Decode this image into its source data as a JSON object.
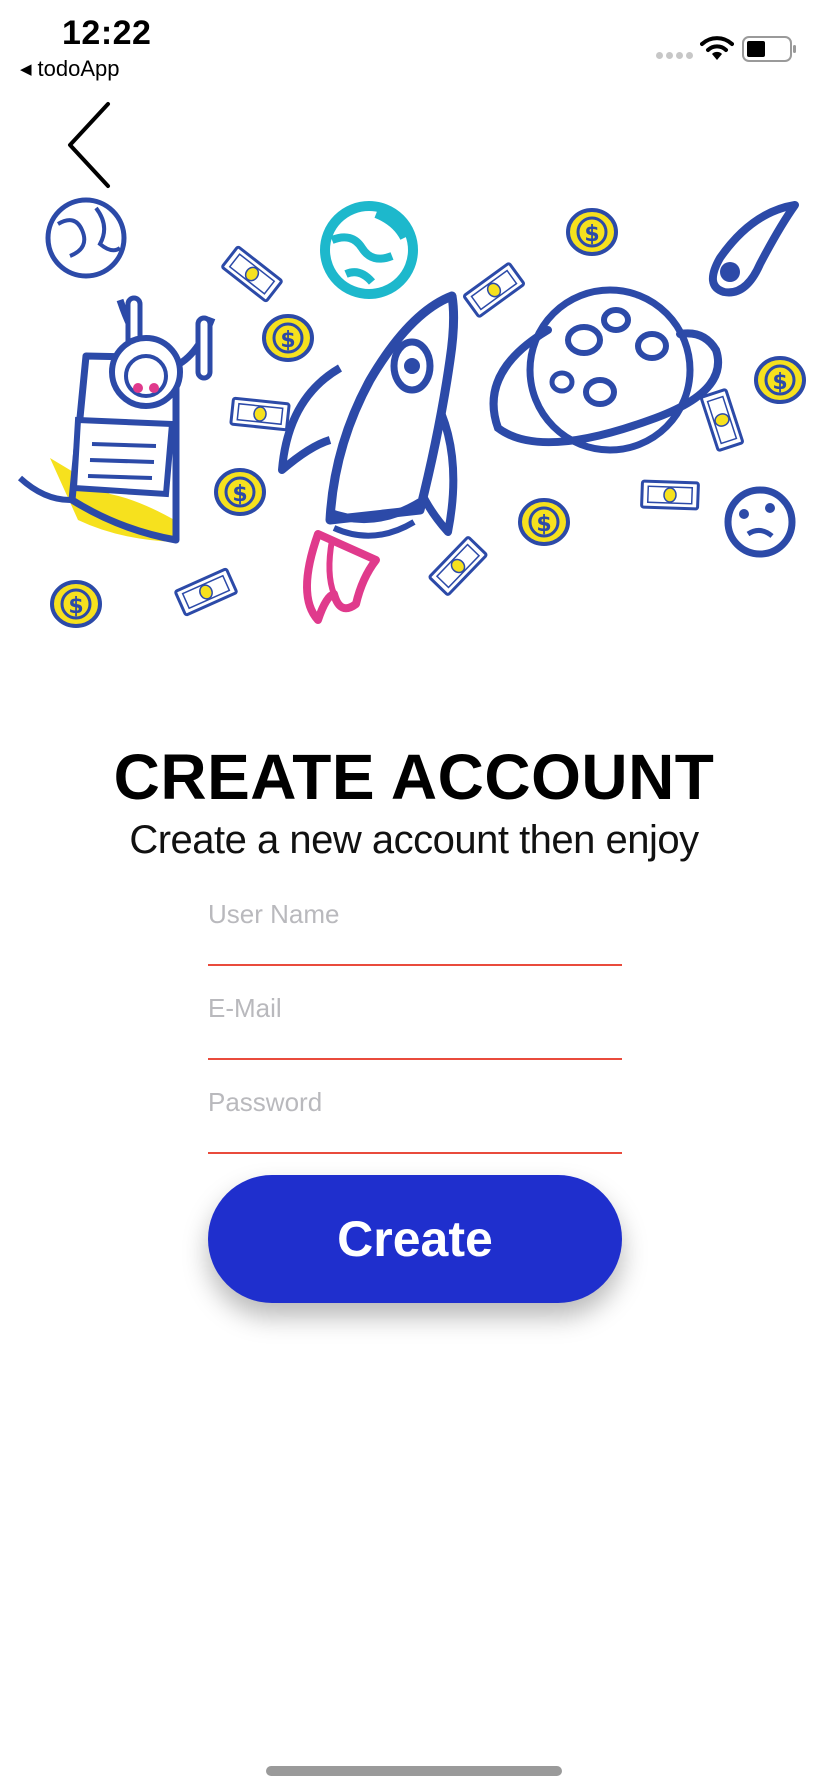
{
  "status_bar": {
    "time": "12:22",
    "back_app_label": "todoApp",
    "back_app_icon": "triangle-left-icon"
  },
  "navigation": {
    "back_icon": "chevron-left-icon"
  },
  "hero": {
    "illustration": "space-rocket-illustration"
  },
  "header": {
    "title": "CREATE ACCOUNT",
    "subtitle": "Create a new account then enjoy"
  },
  "form": {
    "username_placeholder": "User Name",
    "username_value": "",
    "email_placeholder": "E-Mail",
    "email_value": "",
    "password_placeholder": "Password",
    "password_value": "",
    "create_label": "Create"
  },
  "colors": {
    "accent": "#1f2fcd",
    "underline": "#e94b3c",
    "illustration_blue": "#2c4aa8",
    "illustration_yellow": "#f6e11e",
    "illustration_teal": "#1db8cc",
    "illustration_pink": "#e03a8c"
  }
}
